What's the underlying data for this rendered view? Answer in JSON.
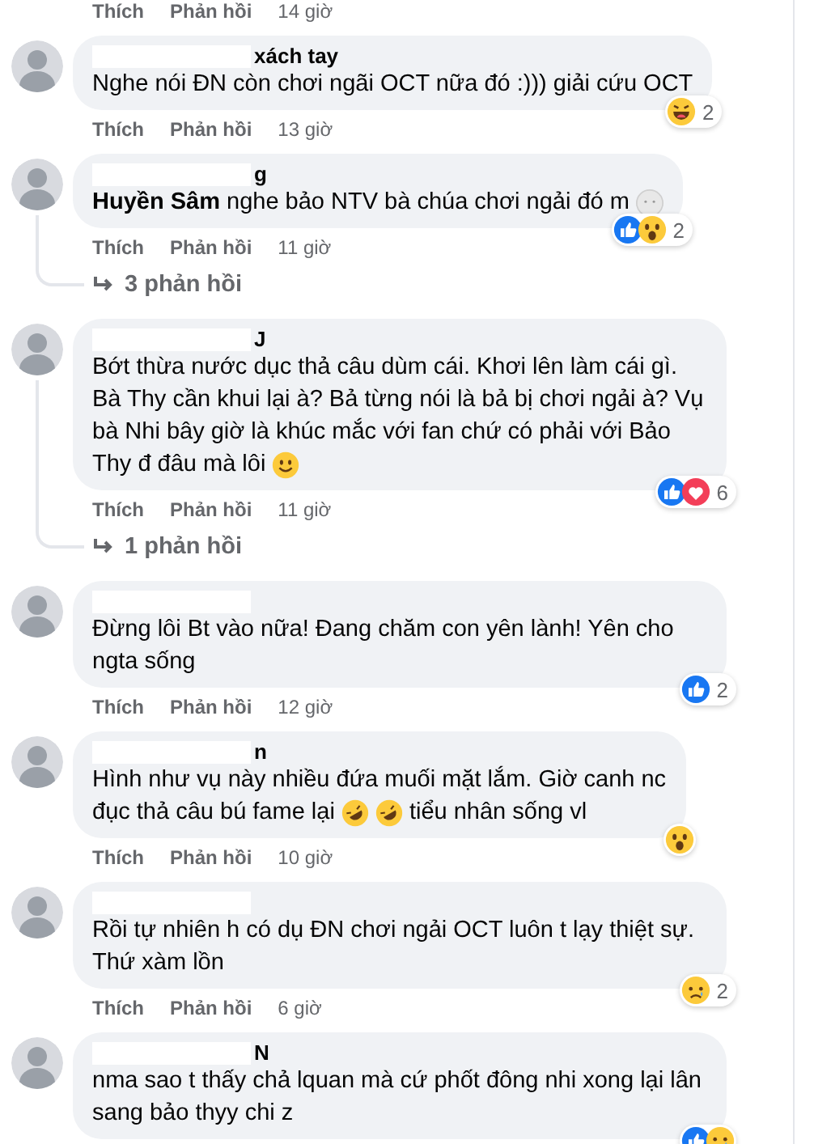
{
  "top_actions": {
    "like": "Thích",
    "reply": "Phản hồi",
    "time": "14 giờ"
  },
  "comments": [
    {
      "name": "xách tay",
      "thread": false,
      "lines": [
        [
          {
            "kind": "text",
            "text": "Nghe nói ĐN còn chơi ngãi OCT nữa đó :))) giải cứu OCT"
          }
        ]
      ],
      "reactions": [
        {
          "kind": "haha"
        }
      ],
      "reaction_count": "2",
      "actions": {
        "like": "Thích",
        "reply": "Phản hồi",
        "time": "13 giờ"
      }
    },
    {
      "name": "g",
      "thread": true,
      "lines": [
        [
          {
            "kind": "text",
            "text": "**Huyền Sâm** nghe bảo NTV bà chúa chơi ngải đó m"
          },
          {
            "kind": "pale"
          }
        ]
      ],
      "reactions": [
        {
          "kind": "like"
        },
        {
          "kind": "wow"
        }
      ],
      "reaction_count": "2",
      "actions": {
        "like": "Thích",
        "reply": "Phản hồi",
        "time": "11 giờ"
      },
      "replies": "3 phản hồi"
    },
    {
      "name": "J",
      "thread": true,
      "lines": [
        [
          {
            "kind": "text",
            "text": "Bớt thừa nước dục thả câu dùm cái. Khơi lên làm cái gì. Bà Thy cần khui lại à? Bả từng nói là bả bị chơi ngải à? Vụ bà Nhi bây giờ là khúc mắc với fan chứ có phải với Bảo"
          }
        ],
        [
          {
            "kind": "text",
            "text": "Thy đ đâu mà lôi"
          },
          {
            "kind": "smile"
          }
        ]
      ],
      "reactions": [
        {
          "kind": "like"
        },
        {
          "kind": "love"
        }
      ],
      "reaction_count": "6",
      "actions": {
        "like": "Thích",
        "reply": "Phản hồi",
        "time": "11 giờ"
      },
      "replies": "1 phản hồi"
    },
    {
      "thread": false,
      "lines": [
        [
          {
            "kind": "text",
            "text": "Đừng lôi Bt vào nữa! Đang chăm con yên lành! Yên cho ngta sống"
          }
        ]
      ],
      "reactions": [
        {
          "kind": "like"
        }
      ],
      "reaction_count": "2",
      "actions": {
        "like": "Thích",
        "reply": "Phản hồi",
        "time": "12 giờ"
      }
    },
    {
      "name": "n",
      "thread": false,
      "lines": [
        [
          {
            "kind": "text",
            "text": "Hình như vụ này nhiều đứa muối mặt lắm. Giờ canh nc"
          }
        ],
        [
          {
            "kind": "text",
            "text": "đục thả câu bú fame lại"
          },
          {
            "kind": "rofl"
          },
          {
            "kind": "rofl"
          },
          {
            "kind": "text",
            "text": "tiểu nhân sống vl"
          }
        ]
      ],
      "reactions": [
        {
          "kind": "wow"
        }
      ],
      "actions": {
        "like": "Thích",
        "reply": "Phản hồi",
        "time": "10 giờ"
      }
    },
    {
      "thread": false,
      "lines": [
        [
          {
            "kind": "text",
            "text": "Rồi tự nhiên h có dụ ĐN chơi ngải OCT luôn t lạy thiệt sự. Thứ xàm lồn"
          }
        ]
      ],
      "reactions": [
        {
          "kind": "sad"
        }
      ],
      "reaction_count": "2",
      "actions": {
        "like": "Thích",
        "reply": "Phản hồi",
        "time": "6 giờ"
      }
    },
    {
      "name": "N",
      "thread": false,
      "lines": [
        [
          {
            "kind": "text",
            "text": "nma sao t thấy chả lquan mà cứ phốt đông nhi xong lại lân sang bảo thyy chi z"
          }
        ]
      ],
      "reactions": [
        {
          "kind": "like"
        },
        {
          "kind": "sad"
        }
      ]
    }
  ]
}
